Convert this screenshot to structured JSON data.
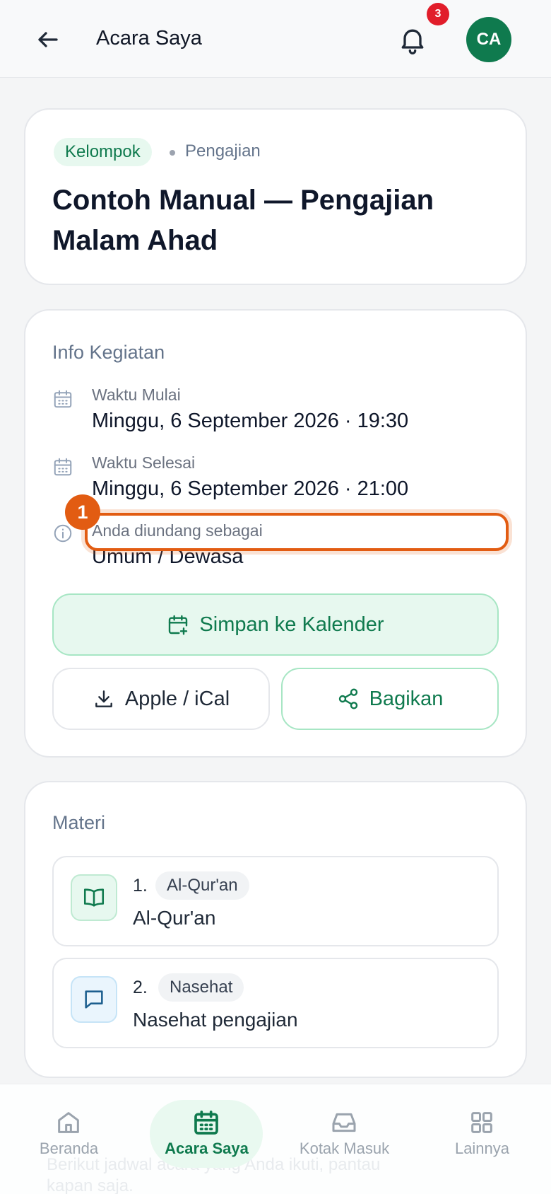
{
  "header": {
    "title": "Acara Saya",
    "notification_count": "3",
    "avatar_initials": "CA"
  },
  "event": {
    "type_chip": "Kelompok",
    "category": "Pengajian",
    "title": "Contoh Manual — Pengajian Malam Ahad"
  },
  "info": {
    "section_title": "Info Kegiatan",
    "start_label": "Waktu Mulai",
    "start_value": "Minggu, 6 September 2026 · 19:30",
    "end_label": "Waktu Selesai",
    "end_value": "Minggu, 6 September 2026 · 21:00",
    "invited_label": "Anda diundang sebagai",
    "invited_value": "Umum / Dewasa",
    "step_marker": "1"
  },
  "actions": {
    "save_calendar": "Simpan ke Kalender",
    "ical": "Apple / iCal",
    "share": "Bagikan"
  },
  "materials": {
    "section_title": "Materi",
    "items": [
      {
        "number": "1.",
        "tag": "Al-Qur'an",
        "title": "Al-Qur'an",
        "icon": "book-icon"
      },
      {
        "number": "2.",
        "tag": "Nasehat",
        "title": "Nasehat pengajian",
        "icon": "message-icon"
      }
    ]
  },
  "background_text": {
    "line1": "Berikut jadwal acara yang Anda ikuti, pantau",
    "line2": "kapan saja."
  },
  "bottom_nav": {
    "items": [
      {
        "label": "Beranda",
        "icon": "home-icon"
      },
      {
        "label": "Acara Saya",
        "icon": "calendar-icon",
        "active": true
      },
      {
        "label": "Kotak Masuk",
        "icon": "inbox-icon"
      },
      {
        "label": "Lainnya",
        "icon": "grid-icon"
      }
    ]
  },
  "colors": {
    "brand_green": "#0f7a4e",
    "highlight_orange": "#e25c12",
    "badge_red": "#e11d2a"
  }
}
